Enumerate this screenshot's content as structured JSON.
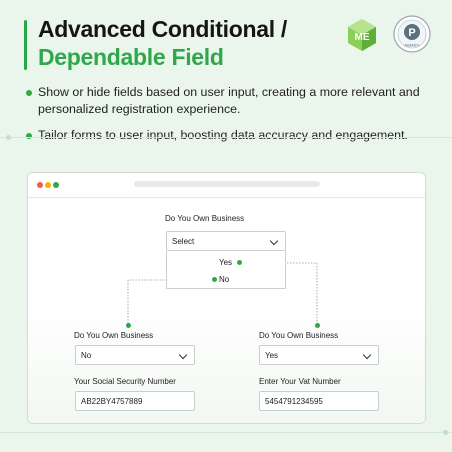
{
  "heading": {
    "line1": "Advanced Conditional /",
    "line2": "Dependable Field"
  },
  "logos": {
    "brand": "me-logo-icon",
    "badge": "partner-badge-icon",
    "badge_letter": "P",
    "badge_caption": "AGENCY"
  },
  "bullets": [
    "Show or hide fields based on user input, creating a more relevant and personalized registration experience.",
    "Tailor forms to user input, boosting data accuracy and engagement."
  ],
  "colors": {
    "accent": "#2ea84a",
    "background": "#eaf5ec",
    "traffic_red": "#f05a4f",
    "traffic_yellow": "#f4b400",
    "traffic_green": "#2ea84a"
  },
  "form": {
    "top_label": "Do You Own Business",
    "top_select": "Select",
    "options": [
      "Yes",
      "No"
    ],
    "left": {
      "label": "Do You Own Business",
      "value": "No",
      "input_label": "Your Social Security Number",
      "input_value": "AB22BY4757889"
    },
    "right": {
      "label": "Do You Own Business",
      "value": "Yes",
      "input_label": "Enter Your Vat Number",
      "input_value": "5454791234595"
    }
  }
}
